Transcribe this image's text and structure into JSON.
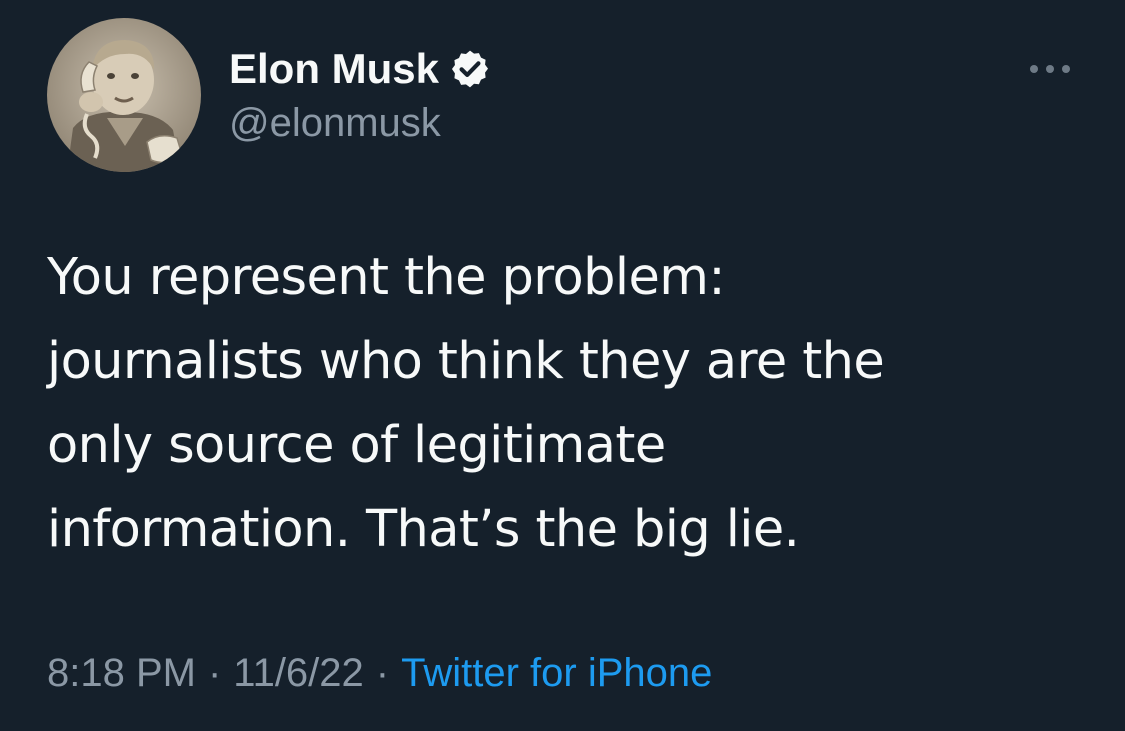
{
  "author": {
    "display_name": "Elon Musk",
    "handle": "@elonmusk",
    "avatar_icon": "avatar-photo",
    "verified_icon": "verified-badge-icon"
  },
  "tweet": {
    "text_lines": [
      "You represent the problem:",
      "journalists who think they are the",
      "only source of legitimate",
      "information. That’s the big lie."
    ]
  },
  "meta": {
    "time": "8:18 PM",
    "separator": "·",
    "date": "11/6/22",
    "source": "Twitter for iPhone"
  },
  "menu": {
    "icon": "more-options-icon"
  },
  "colors": {
    "background": "#15202b",
    "text_primary": "#f7f9f9",
    "text_secondary": "#8b98a5",
    "link": "#1d9bf0"
  }
}
